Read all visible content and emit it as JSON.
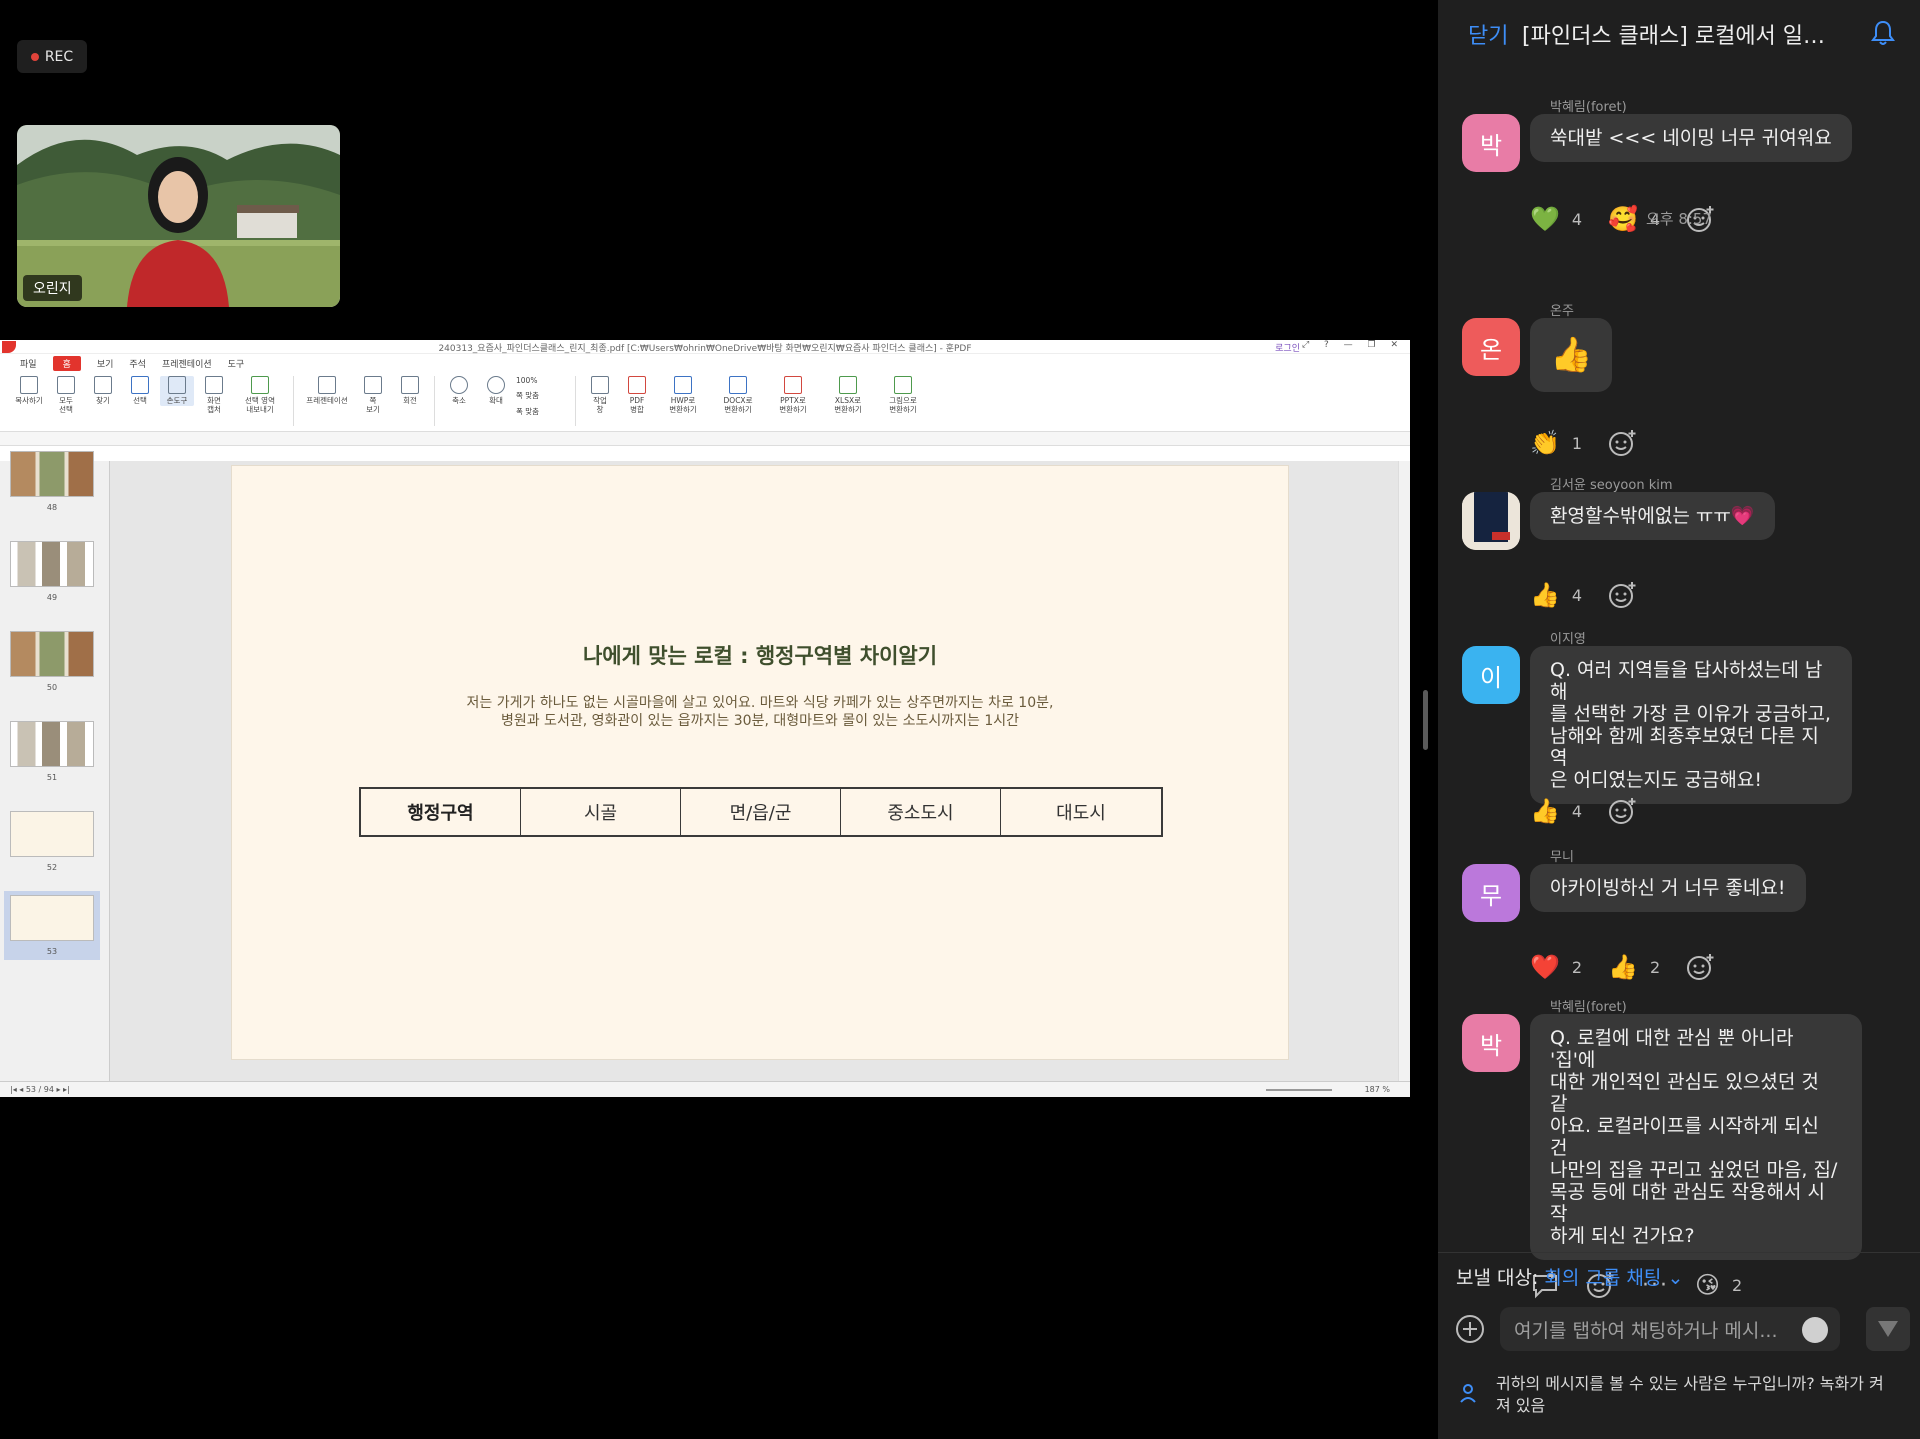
{
  "meeting": {
    "rec_label": "REC",
    "participant_name": "오린지"
  },
  "pdf_viewer": {
    "window_title": "240313_요즘사_파인더스클래스_린지_최종.pdf [C:₩Users₩ohrin₩OneDrive₩바탕 화면₩오린지₩요즘사 파인더스 클래스] - 훈PDF",
    "login_label": "로그인",
    "menu": [
      "파일",
      "홈",
      "보기",
      "주석",
      "프레젠테이션",
      "도구"
    ],
    "ribbon": [
      {
        "label": "복사하기"
      },
      {
        "label": "모두\n선택"
      },
      {
        "label": "찾기"
      },
      {
        "label": "선택"
      },
      {
        "label": "손도구"
      },
      {
        "label": "화면\n캡처"
      },
      {
        "label": "선택 영역\n내보내기"
      },
      {
        "label": "프레젠테이션"
      },
      {
        "label": "쪽\n보기"
      },
      {
        "label": "회전"
      },
      {
        "label": "축소"
      },
      {
        "label": "확대"
      }
    ],
    "zoom_options": [
      "100%",
      "쪽 맞춤",
      "폭 맞춤"
    ],
    "ribbon2": [
      {
        "label": "작업\n창"
      },
      {
        "label": "PDF\n병합"
      },
      {
        "label": "HWP로\n변환하기"
      },
      {
        "label": "DOCX로\n변환하기"
      },
      {
        "label": "PPTX로\n변환하기"
      },
      {
        "label": "XLSX로\n변환하기"
      },
      {
        "label": "그림으로\n변환하기"
      }
    ],
    "thumbnails": [
      "48",
      "49",
      "50",
      "51",
      "52",
      "53"
    ],
    "slide": {
      "title": "나에게 맞는 로컬 : 행정구역별 차이알기",
      "body_line1": "저는 가게가 하나도 없는 시골마을에 살고 있어요. 마트와 식당 카페가 있는 상주면까지는 차로 10분,",
      "body_line2": "병원과 도서관, 영화관이 있는 읍까지는 30분, 대형마트와 몰이 있는 소도시까지는 1시간",
      "table": [
        "행정구역",
        "시골",
        "면/읍/군",
        "중소도시",
        "대도시"
      ]
    },
    "status": {
      "page_indicator": "53 / 94",
      "zoom": "187 %"
    }
  },
  "chat": {
    "close_label": "닫기",
    "title": "[파인더스 클래스] 로컬에서 일…",
    "time_divider": "오후 8:57",
    "messages": [
      {
        "sender": "박혜림(foret)",
        "avatar": "박",
        "avatar_color": "#e87ca6",
        "text": "쑥대밭 <<< 네이밍 너무 귀여워요",
        "reactions": [
          {
            "emoji": "💚",
            "count": "4"
          },
          {
            "emoji": "🥰",
            "count": "4"
          }
        ]
      },
      {
        "sender": "온주",
        "avatar": "온",
        "avatar_color": "#ee5b5b",
        "text": "👍",
        "reactions": [
          {
            "emoji": "👏",
            "count": "1"
          }
        ]
      },
      {
        "sender": "김서윤 seoyoon kim",
        "avatar": "",
        "avatar_color": "#e8e2d8",
        "text": "환영할수밖에없는 ㅠㅠ💗",
        "reactions": [
          {
            "emoji": "👍",
            "count": "4"
          }
        ]
      },
      {
        "sender": "이지영",
        "avatar": "이",
        "avatar_color": "#3ab3f0",
        "text": "Q. 여러 지역들을 답사하셨는데 남해\n를 선택한 가장 큰 이유가 궁금하고,\n남해와 함께 최종후보였던 다른 지역\n은 어디였는지도 궁금해요!",
        "reactions": [
          {
            "emoji": "👍",
            "count": "4"
          }
        ]
      },
      {
        "sender": "무니",
        "avatar": "무",
        "avatar_color": "#bb78db",
        "text": "아카이빙하신 거 너무 좋네요!",
        "reactions": [
          {
            "emoji": "❤️",
            "count": "2"
          },
          {
            "emoji": "👍",
            "count": "2"
          }
        ]
      },
      {
        "sender": "박혜림(foret)",
        "avatar": "박",
        "avatar_color": "#e87ca6",
        "text": "Q. 로컬에 대한 관심 뿐 아니라 '집'에\n대한 개인적인 관심도 있으셨던 것 같\n아요. 로컬라이프를 시작하게 되신 건\n나만의 집을 꾸리고 싶었던 마음, 집/\n목공 등에 대한 관심도 작용해서 시작\n하게 되신 건가요?",
        "reactions": [
          {
            "emoji": "😘",
            "count": "2"
          }
        ]
      }
    ],
    "compose": {
      "send_to_label": "보낼 대상:",
      "send_to_group": "회의 그룹 채팅",
      "placeholder": "여기를 탭하여 채팅하거나 메시...",
      "notice": "귀하의 메시지를 볼 수 있는 사람은 누구입니까? 녹화가 켜져 있음"
    }
  }
}
